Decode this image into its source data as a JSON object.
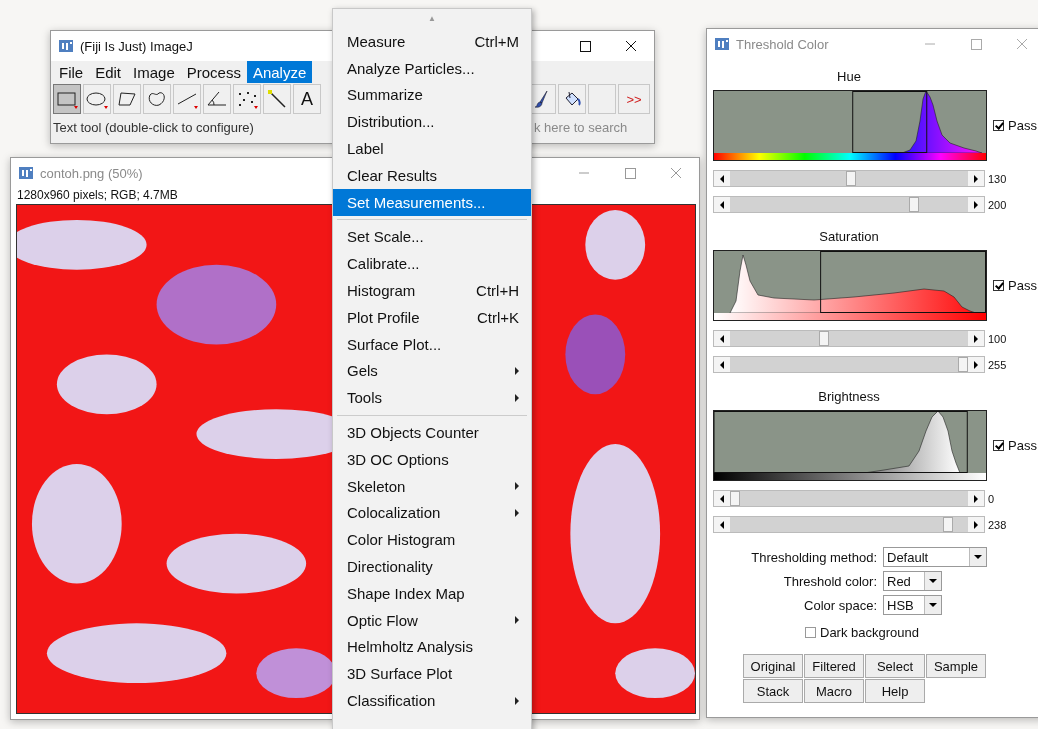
{
  "main_window": {
    "title": "(Fiji Is Just) ImageJ",
    "menu": [
      {
        "label": "File",
        "selected": false
      },
      {
        "label": "Edit",
        "selected": false
      },
      {
        "label": "Image",
        "selected": false
      },
      {
        "label": "Process",
        "selected": false
      },
      {
        "label": "Analyze",
        "selected": true
      }
    ],
    "tools_left": [
      {
        "kind": "rectangle",
        "selected": true
      },
      {
        "kind": "oval",
        "selected": false
      },
      {
        "kind": "polygon",
        "selected": false
      },
      {
        "kind": "freehand",
        "selected": false
      },
      {
        "kind": "line",
        "selected": false
      },
      {
        "kind": "angle",
        "selected": false
      },
      {
        "kind": "multipoint",
        "selected": false
      },
      {
        "kind": "wand",
        "selected": false
      },
      {
        "kind": "text",
        "label": "A",
        "selected": false
      }
    ],
    "tools_right": [
      {
        "kind": "brush",
        "selected": false
      },
      {
        "kind": "bucket",
        "selected": false
      },
      {
        "kind": "blank",
        "selected": false
      },
      {
        "kind": "more",
        "label": ">>",
        "selected": false
      }
    ],
    "status": "Text tool (double-click to configure)",
    "search": {
      "placeholder": "k here to search"
    }
  },
  "image_window": {
    "title": "contoh.png (50%)",
    "info": "1280x960 pixels; RGB; 4.7MB"
  },
  "analyze_menu": {
    "scroll_up": "▲",
    "items": [
      {
        "kind": "item",
        "label": "Measure",
        "shortcut": "Ctrl+M",
        "submenu": false,
        "selected": false
      },
      {
        "kind": "item",
        "label": "Analyze Particles...",
        "submenu": false,
        "selected": false
      },
      {
        "kind": "item",
        "label": "Summarize",
        "submenu": false,
        "selected": false
      },
      {
        "kind": "item",
        "label": "Distribution...",
        "submenu": false,
        "selected": false
      },
      {
        "kind": "item",
        "label": "Label",
        "submenu": false,
        "selected": false
      },
      {
        "kind": "item",
        "label": "Clear Results",
        "submenu": false,
        "selected": false
      },
      {
        "kind": "item",
        "label": "Set Measurements...",
        "submenu": false,
        "selected": true
      },
      {
        "kind": "separator"
      },
      {
        "kind": "item",
        "label": "Set Scale...",
        "submenu": false,
        "selected": false
      },
      {
        "kind": "item",
        "label": "Calibrate...",
        "submenu": false,
        "selected": false
      },
      {
        "kind": "item",
        "label": "Histogram",
        "shortcut": "Ctrl+H",
        "submenu": false,
        "selected": false
      },
      {
        "kind": "item",
        "label": "Plot Profile",
        "shortcut": "Ctrl+K",
        "submenu": false,
        "selected": false
      },
      {
        "kind": "item",
        "label": "Surface Plot...",
        "submenu": false,
        "selected": false
      },
      {
        "kind": "item",
        "label": "Gels",
        "submenu": true,
        "selected": false
      },
      {
        "kind": "item",
        "label": "Tools",
        "submenu": true,
        "selected": false
      },
      {
        "kind": "separator"
      },
      {
        "kind": "item",
        "label": "3D Objects Counter",
        "submenu": false,
        "selected": false
      },
      {
        "kind": "item",
        "label": "3D OC Options",
        "submenu": false,
        "selected": false
      },
      {
        "kind": "item",
        "label": "Skeleton",
        "submenu": true,
        "selected": false
      },
      {
        "kind": "item",
        "label": "Colocalization",
        "submenu": true,
        "selected": false
      },
      {
        "kind": "item",
        "label": "Color Histogram",
        "submenu": false,
        "selected": false
      },
      {
        "kind": "item",
        "label": "Directionality",
        "submenu": false,
        "selected": false
      },
      {
        "kind": "item",
        "label": "Shape Index Map",
        "submenu": false,
        "selected": false
      },
      {
        "kind": "item",
        "label": "Optic Flow",
        "submenu": true,
        "selected": false
      },
      {
        "kind": "item",
        "label": "Helmholtz Analysis",
        "submenu": false,
        "selected": false
      },
      {
        "kind": "item",
        "label": "3D Surface Plot",
        "submenu": false,
        "selected": false
      },
      {
        "kind": "item",
        "label": "Classification",
        "submenu": true,
        "selected": false
      }
    ]
  },
  "threshold_window": {
    "title": "Threshold Color",
    "channels": [
      {
        "kind": "hue",
        "title": "Hue",
        "pass": {
          "label": "Pass",
          "checked": true
        },
        "sliders": [
          {
            "level": 0.51,
            "reading": "130"
          },
          {
            "level": 0.784,
            "reading": "200"
          }
        ]
      },
      {
        "kind": "saturation",
        "title": "Saturation",
        "pass": {
          "label": "Pass",
          "checked": true
        },
        "sliders": [
          {
            "level": 0.392,
            "reading": "100"
          },
          {
            "level": 1,
            "reading": "255"
          }
        ]
      },
      {
        "kind": "brightness",
        "title": "Brightness",
        "pass": {
          "label": "Pass",
          "checked": true
        },
        "sliders": [
          {
            "level": 0,
            "reading": "0"
          },
          {
            "level": 0.933,
            "reading": "238"
          }
        ]
      }
    ],
    "options": [
      {
        "label": "Thresholding method:",
        "value": "Default"
      },
      {
        "label": "Threshold color:",
        "value": "Red"
      },
      {
        "label": "Color space:",
        "value": "HSB"
      }
    ],
    "dark_background": {
      "label": "Dark background",
      "checked": false
    },
    "button_rows": [
      [
        "Original",
        "Filtered",
        "Select",
        "Sample"
      ],
      [
        "Stack",
        "Macro",
        "Help"
      ]
    ]
  }
}
